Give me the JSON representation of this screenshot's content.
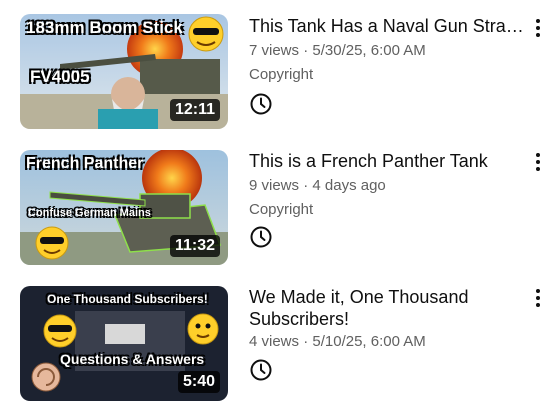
{
  "videos": [
    {
      "title": "This Tank Has a Naval Gun Stra…",
      "views": "7 views",
      "date": "5/30/25, 6:00 AM",
      "license": "Copyright",
      "duration": "12:11",
      "overlay_top": "183mm Boom Stick",
      "overlay_mid": "FV4005",
      "icon": "clock-icon"
    },
    {
      "title": "This is a French Panther Tank",
      "views": "9 views",
      "date": "4 days ago",
      "license": "Copyright",
      "duration": "11:32",
      "overlay_top": "French Panther",
      "overlay_mid": "Confuse German Mains",
      "icon": "clock-icon"
    },
    {
      "title": "We Made it, One Thousand Subscribers!",
      "views": "4 views",
      "date": "5/10/25, 6:00 AM",
      "duration": "5:40",
      "overlay_top": "One Thousand Subscribers!",
      "overlay_mid": "Questions & Answers",
      "icon": "clock-icon"
    }
  ],
  "colors": {
    "text": "#0f0f0f",
    "meta": "#606060",
    "duration_bg": "#000000"
  }
}
